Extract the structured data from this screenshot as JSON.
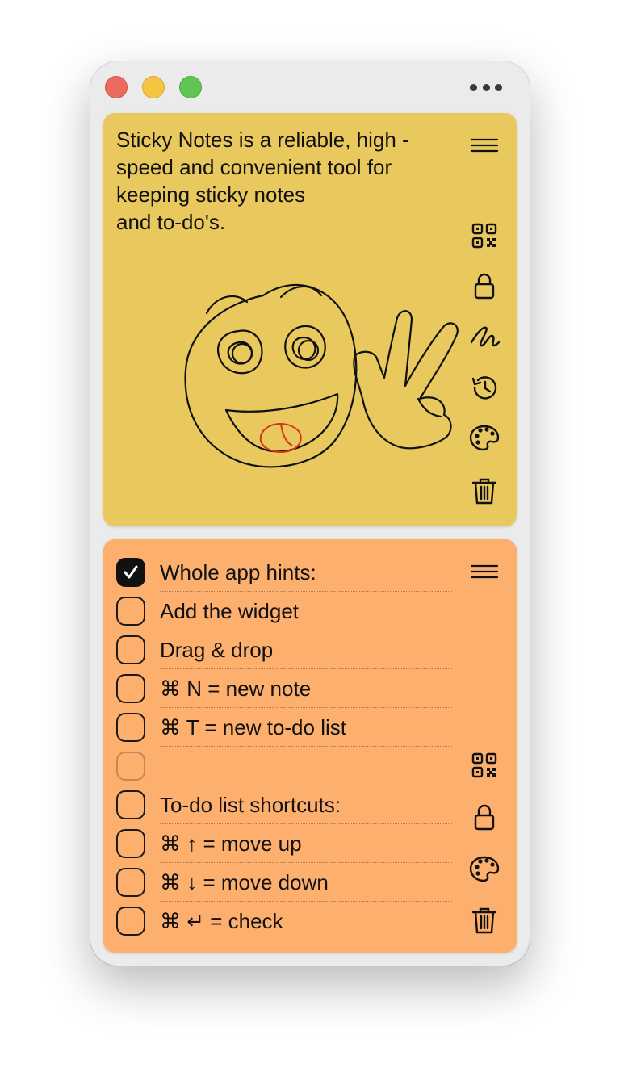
{
  "window": {
    "menu_icon": "more-horizontal-icon"
  },
  "note1": {
    "color": "#e9c95e",
    "text": "Sticky Notes is a reliable, high -\nspeed and convenient tool for\nkeeping sticky notes\nand to-do's.",
    "tools": [
      "menu-icon",
      "qr-code-icon",
      "lock-icon",
      "scribble-icon",
      "history-icon",
      "palette-icon",
      "trash-icon"
    ]
  },
  "note2": {
    "color": "#fdaf6e",
    "tools": [
      "menu-icon",
      "qr-code-icon",
      "lock-icon",
      "palette-icon",
      "trash-icon"
    ],
    "items": [
      {
        "label": "Whole app hints:",
        "checked": true
      },
      {
        "label": "Add the widget",
        "checked": false
      },
      {
        "label": "Drag & drop",
        "checked": false
      },
      {
        "label": "⌘ N = new note",
        "checked": false
      },
      {
        "label": "⌘ T = new to-do list",
        "checked": false
      },
      {
        "label": "",
        "checked": false
      },
      {
        "label": "To-do list shortcuts:",
        "checked": false
      },
      {
        "label": "⌘ ↑ = move up",
        "checked": false
      },
      {
        "label": "⌘ ↓ = move down",
        "checked": false
      },
      {
        "label": "⌘ ↵ = check",
        "checked": false
      }
    ]
  }
}
